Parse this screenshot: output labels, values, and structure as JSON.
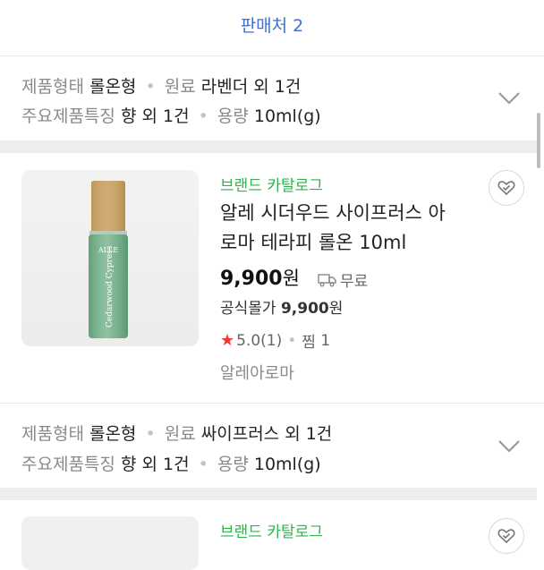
{
  "sellers": {
    "label": "판매처 2"
  },
  "product1": {
    "specs_line1": [
      {
        "key": "제품형태",
        "value": "롤온형"
      },
      {
        "key": "원료",
        "value": "라벤더 외 1건"
      }
    ],
    "specs_line2": [
      {
        "key": "주요제품특징",
        "value": "향 외 1건"
      },
      {
        "key": "용량",
        "value": "10ml(g)"
      }
    ]
  },
  "product2": {
    "brand": "브랜드 카탈로그",
    "title_line1": "알레 시더우드 사이프러스 아",
    "title_line2": "로마 테라피 롤온 10ml",
    "price": "9,900",
    "price_unit": "원",
    "shipping": "무료",
    "official_label": "공식몰가",
    "official_price": "9,900",
    "official_unit": "원",
    "rating": "5.0(1)",
    "wish_label": "찜",
    "wish_count": "1",
    "store": "알레아로마",
    "image_label_brand": "ALLE",
    "image_label_text": "Cedarwood Cypress",
    "specs_line1": [
      {
        "key": "제품형태",
        "value": "롤온형"
      },
      {
        "key": "원료",
        "value": "싸이프러스 외 1건"
      }
    ],
    "specs_line2": [
      {
        "key": "주요제품특징",
        "value": "향 외 1건"
      },
      {
        "key": "용량",
        "value": "10ml(g)"
      }
    ]
  },
  "product3": {
    "brand": "브랜드 카탈로그"
  },
  "colors": {
    "brand_green": "#2fb34a",
    "link_blue": "#3a6fd8",
    "star_red": "#f03a2c"
  },
  "icons": {
    "chevron": "chevron-down-icon",
    "heart": "heart-check-icon",
    "truck": "truck-icon",
    "star": "star-icon"
  }
}
